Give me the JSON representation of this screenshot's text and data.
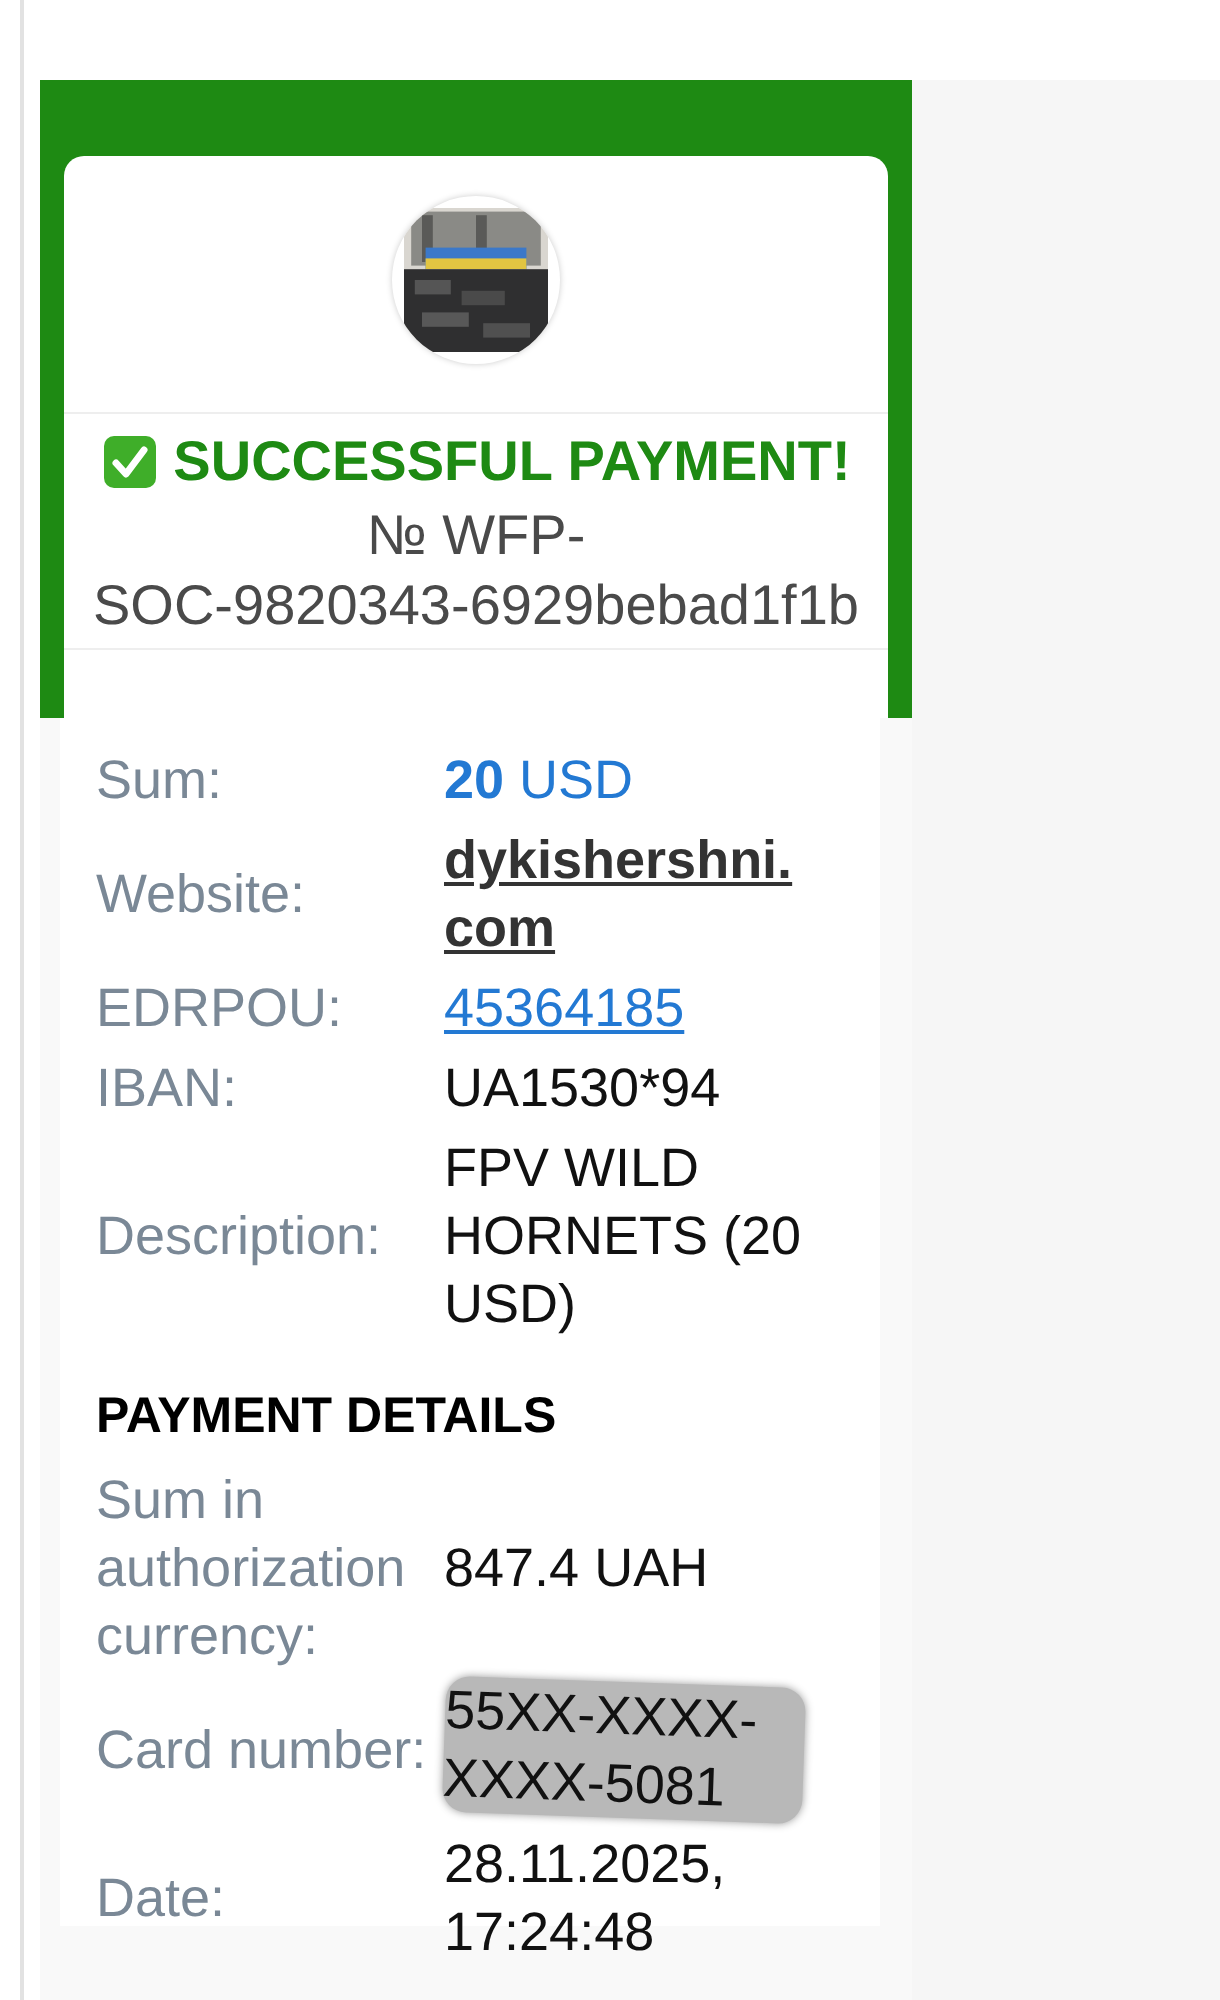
{
  "status": {
    "kind": "success",
    "title": "SUCCESSFUL PAYMENT!",
    "number_lines": [
      "№ WFP-",
      "SOC-9820343-6929bebad1f1b"
    ]
  },
  "details": [
    {
      "label": "Sum:",
      "value": "**20** USD",
      "kind": "amount"
    },
    {
      "label": "Website:",
      "value": "dykishershni.com",
      "kind": "site-link"
    },
    {
      "label": "EDRPOU:",
      "value": "45364185",
      "kind": "link"
    },
    {
      "label": "IBAN:",
      "value": "UA1530*94",
      "kind": "text"
    },
    {
      "label": "Description:",
      "value": "FPV WILD HORNETS (20 USD)",
      "kind": "text"
    }
  ],
  "payment_details": {
    "title": "PAYMENT DETAILS",
    "rows": [
      {
        "label": "Sum in authorization currency:",
        "value": "847.4 UAH",
        "kind": "text"
      },
      {
        "label": "Card number:",
        "value": "55XX-XXXX-XXXX-5081",
        "kind": "redacted"
      },
      {
        "label": "Date:",
        "value": "28.11.2025, 17:24:48",
        "kind": "text"
      }
    ]
  }
}
